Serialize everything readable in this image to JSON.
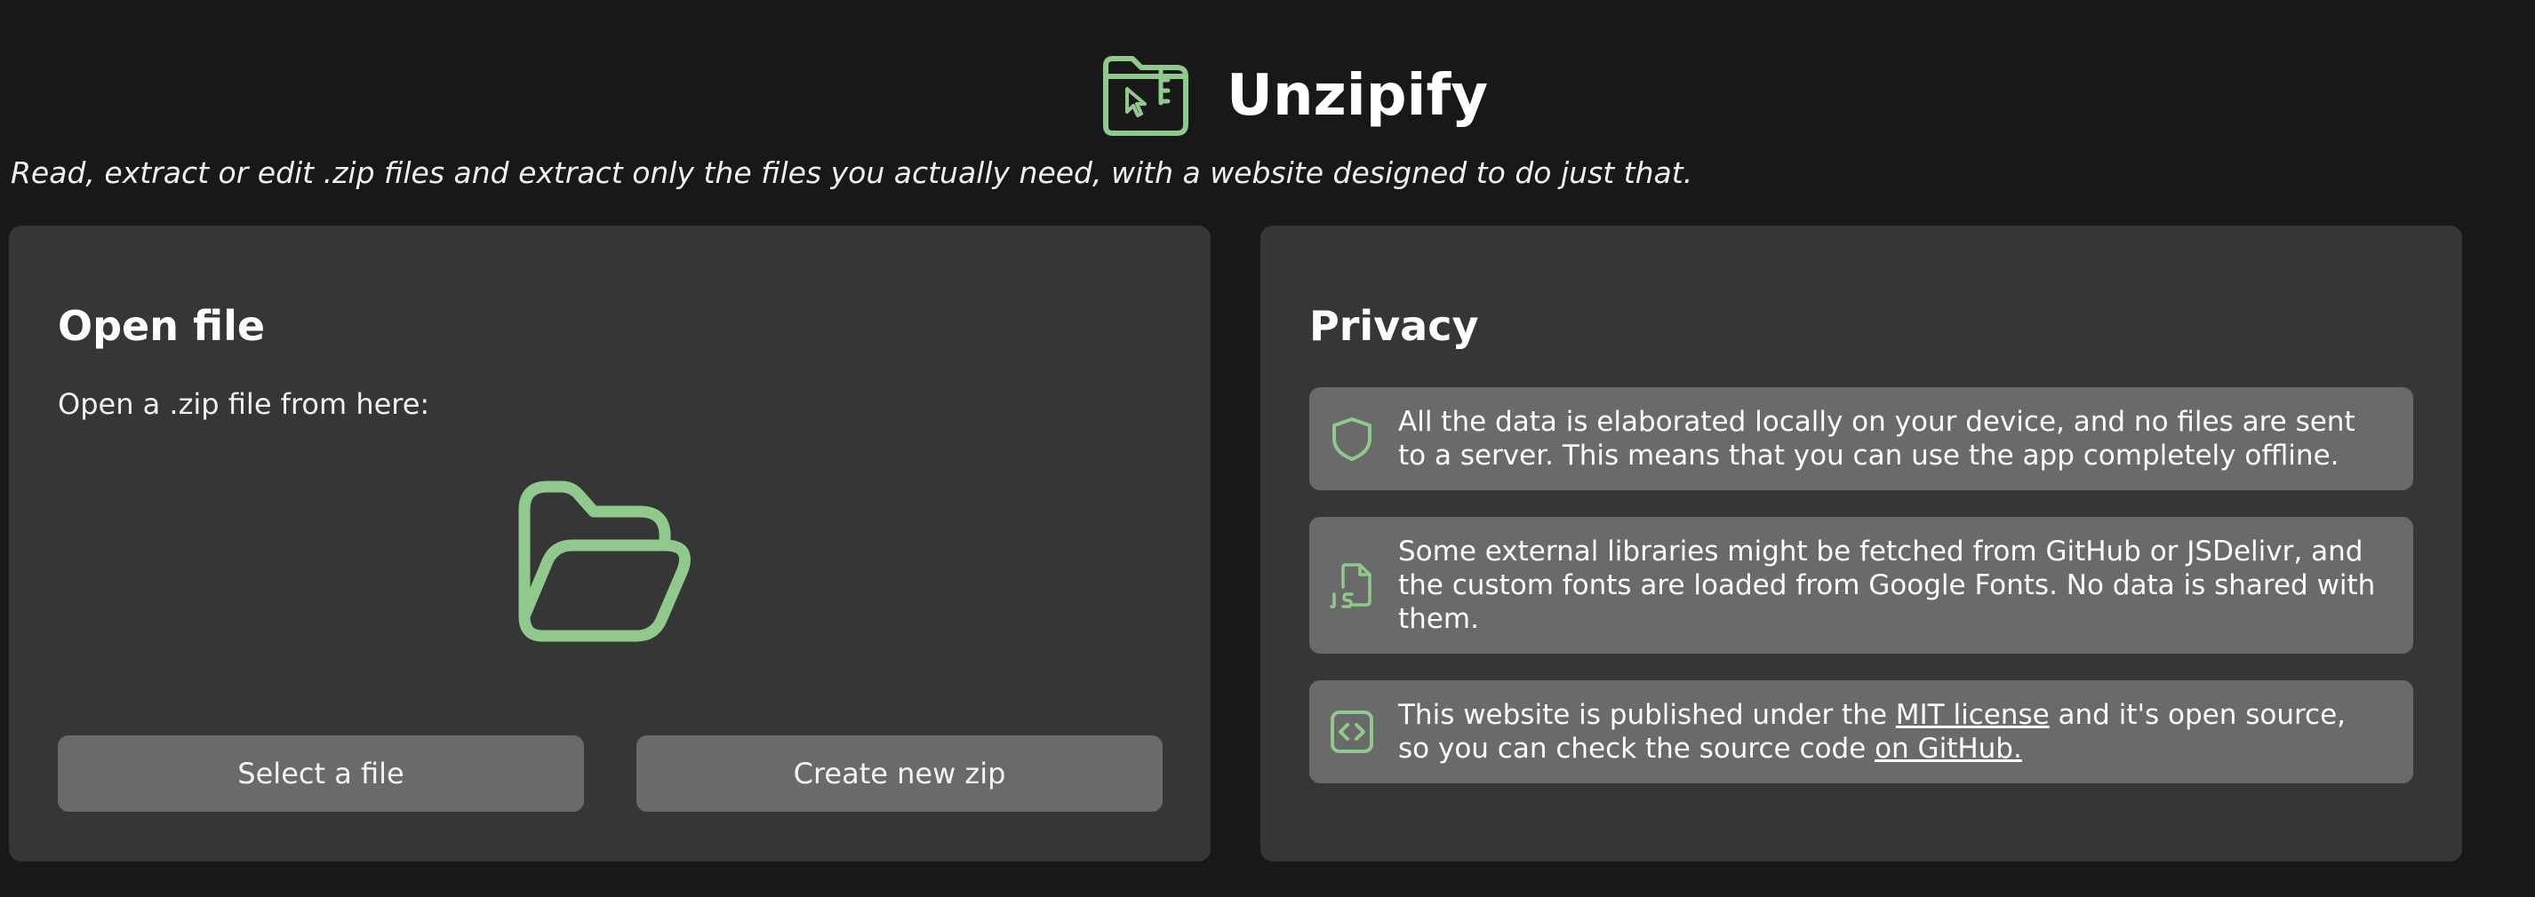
{
  "app": {
    "title": "Unzipify",
    "tagline": "Read, extract or edit .zip files and extract only the files you actually need, with a website designed to do just that.",
    "logo_icon": "zip-folder-cursor-icon",
    "accent_color": "#8fc98b"
  },
  "open_file": {
    "title": "Open file",
    "description": "Open a .zip file from here:",
    "drop_icon": "folder-open-icon",
    "select_label": "Select a file",
    "create_label": "Create new zip"
  },
  "privacy": {
    "title": "Privacy",
    "items": [
      {
        "icon": "shield-icon",
        "text": "All the data is elaborated locally on your device, and no files are sent to a server. This means that you can use the app completely offline."
      },
      {
        "icon": "js-file-icon",
        "text": "Some external libraries might be fetched from GitHub or JSDelivr, and the custom fonts are loaded from Google Fonts. No data is shared with them."
      },
      {
        "icon": "code-icon",
        "text_before": "This website is published under the ",
        "license_link": "MIT license",
        "text_middle": " and it's open source, so you can check the source code ",
        "github_link": "on GitHub."
      }
    ]
  }
}
